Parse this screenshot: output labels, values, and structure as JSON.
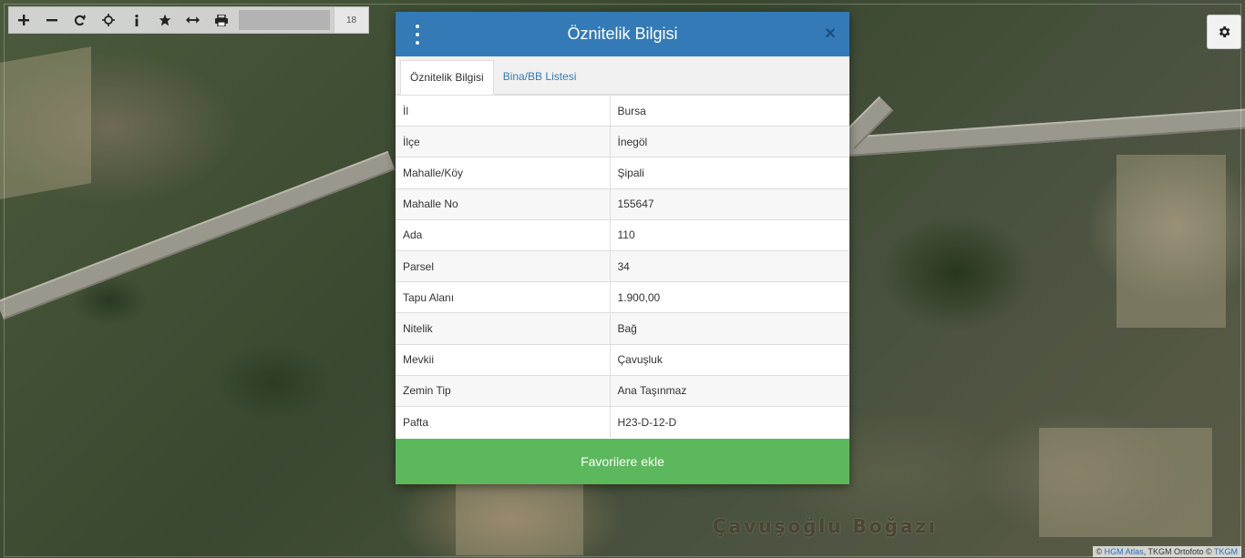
{
  "toolbar": {
    "zoom_level": "18",
    "buttons": [
      {
        "icon": "plus-icon",
        "label": "+"
      },
      {
        "icon": "minus-icon",
        "label": "−"
      },
      {
        "icon": "refresh-icon",
        "label": "⟳"
      },
      {
        "icon": "crosshair-icon",
        "label": "⌖"
      },
      {
        "icon": "info-icon",
        "label": "i"
      },
      {
        "icon": "star-icon",
        "label": "★"
      },
      {
        "icon": "measure-icon",
        "label": "⟷"
      },
      {
        "icon": "print-icon",
        "label": "⎙"
      }
    ]
  },
  "map": {
    "place_label": "Çavuşoğlu Boğazı",
    "attribution": {
      "prefix": "© ",
      "link1": "HGM Atlas",
      "middle": ", TKGM Ortofoto © ",
      "link2": "TKGM"
    }
  },
  "modal": {
    "title": "Öznitelik Bilgisi",
    "close_label": "×",
    "tabs": [
      {
        "label": "Öznitelik Bilgisi",
        "active": true
      },
      {
        "label": "Bina/BB Listesi",
        "active": false
      }
    ],
    "rows": [
      {
        "key": "İl",
        "value": "Bursa"
      },
      {
        "key": "İlçe",
        "value": "İnegöl"
      },
      {
        "key": "Mahalle/Köy",
        "value": "Şipali"
      },
      {
        "key": "Mahalle No",
        "value": "155647"
      },
      {
        "key": "Ada",
        "value": "110"
      },
      {
        "key": "Parsel",
        "value": "34"
      },
      {
        "key": "Tapu Alanı",
        "value": "1.900,00"
      },
      {
        "key": "Nitelik",
        "value": "Bağ"
      },
      {
        "key": "Mevkii",
        "value": "Çavuşluk"
      },
      {
        "key": "Zemin Tip",
        "value": "Ana Taşınmaz"
      },
      {
        "key": "Pafta",
        "value": "H23-D-12-D"
      }
    ],
    "favorite_label": "Favorilere ekle"
  },
  "colors": {
    "header_blue": "#337ab7",
    "favorite_green": "#5cb85c",
    "link_blue": "#337ab7"
  }
}
